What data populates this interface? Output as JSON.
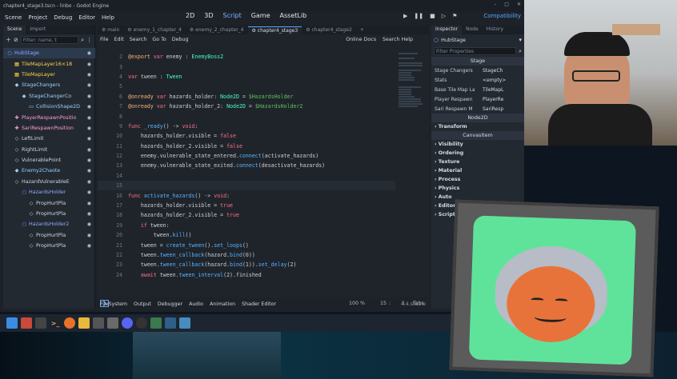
{
  "window": {
    "title": "chapter4_stage3.tscn - linbo - Godot Engine",
    "controls": [
      "–",
      "□",
      "✕"
    ]
  },
  "menu": [
    "Scene",
    "Project",
    "Debug",
    "Editor",
    "Help"
  ],
  "modes": [
    "2D",
    "3D",
    "Script",
    "Game",
    "AssetLib"
  ],
  "active_mode": "Script",
  "compat": "Compatibility",
  "scene_dock": {
    "tabs": [
      "Scene",
      "Import"
    ],
    "filter_placeholder": "Filter: name, t",
    "nodes": [
      {
        "name": "HubStage",
        "depth": 0,
        "icon": "○",
        "color": "#8fa8ff",
        "selected": true
      },
      {
        "name": "TileMapLayer16×18",
        "depth": 1,
        "icon": "▦",
        "color": "#ffd54a"
      },
      {
        "name": "TileMapLayer",
        "depth": 1,
        "icon": "▦",
        "color": "#ffd54a"
      },
      {
        "name": "StageChangers",
        "depth": 1,
        "icon": "◆",
        "color": "#9ad0ff"
      },
      {
        "name": "StageChangerCo",
        "depth": 2,
        "icon": "◆",
        "color": "#9ad0ff"
      },
      {
        "name": "CollisionShape2D",
        "depth": 3,
        "icon": "▭",
        "color": "#9ad0ff"
      },
      {
        "name": "PlayerRespawnPositio",
        "depth": 1,
        "icon": "✚",
        "color": "#ff9bd9"
      },
      {
        "name": "SariRespawnPosition",
        "depth": 1,
        "icon": "✚",
        "color": "#ff9bd9"
      },
      {
        "name": "LeftLimit",
        "depth": 1,
        "icon": "◇",
        "color": "#cfd6df"
      },
      {
        "name": "RightLimit",
        "depth": 1,
        "icon": "◇",
        "color": "#cfd6df"
      },
      {
        "name": "VulnerablePoint",
        "depth": 1,
        "icon": "◇",
        "color": "#cfd6df"
      },
      {
        "name": "Enemy2Chaote",
        "depth": 1,
        "icon": "◆",
        "color": "#9ad0ff"
      },
      {
        "name": "HazardVulnerableE",
        "depth": 1,
        "icon": "◇",
        "color": "#cfd6df"
      },
      {
        "name": "HazardsHolder",
        "depth": 2,
        "icon": "○",
        "color": "#8fa8ff"
      },
      {
        "name": "PropHurtPla",
        "depth": 3,
        "icon": "◇",
        "color": "#cfd6df"
      },
      {
        "name": "PropHurtPla",
        "depth": 3,
        "icon": "◇",
        "color": "#cfd6df"
      },
      {
        "name": "HazardsHolder2",
        "depth": 2,
        "icon": "○",
        "color": "#8fa8ff"
      },
      {
        "name": "PropHurtPla",
        "depth": 3,
        "icon": "◇",
        "color": "#cfd6df"
      },
      {
        "name": "PropHurtPla",
        "depth": 3,
        "icon": "◇",
        "color": "#cfd6df"
      }
    ]
  },
  "script_tabs": [
    "main",
    "enemy_1_chapter_4",
    "enemy_2_chapter_4",
    "chapter4_stage3",
    "chapter4_stage2"
  ],
  "active_script_tab": "chapter4_stage3",
  "editor_menu": [
    "File",
    "Edit",
    "Search",
    "Go To",
    "Debug"
  ],
  "editor_menu_right": [
    "Online Docs",
    "Search Help"
  ],
  "code_lines": [
    {
      "n": "2",
      "tokens": [
        [
          "an",
          "@export "
        ],
        [
          "kw",
          "var "
        ],
        [
          "df",
          "enemy : "
        ],
        [
          "ty",
          "EnemyBoss2"
        ]
      ]
    },
    {
      "n": "3",
      "tokens": []
    },
    {
      "n": "4",
      "tokens": [
        [
          "kw",
          "var "
        ],
        [
          "df",
          "tween : "
        ],
        [
          "ty",
          "Tween"
        ]
      ]
    },
    {
      "n": "5",
      "tokens": []
    },
    {
      "n": "6",
      "tokens": [
        [
          "an",
          "@onready "
        ],
        [
          "kw",
          "var "
        ],
        [
          "df",
          "hazards_holder: "
        ],
        [
          "ty",
          "Node2D "
        ],
        [
          "df",
          "= "
        ],
        [
          "nd",
          "$HazardsHolder"
        ]
      ]
    },
    {
      "n": "7",
      "tokens": [
        [
          "an",
          "@onready "
        ],
        [
          "kw",
          "var "
        ],
        [
          "df",
          "hazards_holder_2: "
        ],
        [
          "ty",
          "Node2D "
        ],
        [
          "df",
          "= "
        ],
        [
          "nd",
          "$HazardsHolder2"
        ]
      ]
    },
    {
      "n": "8",
      "tokens": []
    },
    {
      "n": "9",
      "tokens": [
        [
          "kw",
          "func "
        ],
        [
          "fn",
          "_ready"
        ],
        [
          "df",
          "() -> "
        ],
        [
          "kw",
          "void"
        ],
        [
          "df",
          ":"
        ]
      ]
    },
    {
      "n": "10",
      "tokens": [
        [
          "df",
          "    hazards_holder.visible = "
        ],
        [
          "kw",
          "false"
        ]
      ]
    },
    {
      "n": "11",
      "tokens": [
        [
          "df",
          "    hazards_holder_2.visible = "
        ],
        [
          "kw",
          "false"
        ]
      ]
    },
    {
      "n": "12",
      "tokens": [
        [
          "df",
          "    enemy.vulnerable_state_entered."
        ],
        [
          "fn",
          "connect"
        ],
        [
          "df",
          "(activate_hazards)"
        ]
      ]
    },
    {
      "n": "13",
      "tokens": [
        [
          "df",
          "    enemy.vulnerable_state_exited."
        ],
        [
          "fn",
          "connect"
        ],
        [
          "df",
          "(desactivate_hazards)"
        ]
      ]
    },
    {
      "n": "14",
      "tokens": []
    },
    {
      "n": "15",
      "tokens": [],
      "current": true
    },
    {
      "n": "16",
      "tokens": [
        [
          "kw",
          "func "
        ],
        [
          "fn",
          "activate_hazards"
        ],
        [
          "df",
          "() -> "
        ],
        [
          "kw",
          "void"
        ],
        [
          "df",
          ":"
        ]
      ]
    },
    {
      "n": "17",
      "tokens": [
        [
          "df",
          "    hazards_holder.visible = "
        ],
        [
          "kw",
          "true"
        ]
      ]
    },
    {
      "n": "18",
      "tokens": [
        [
          "df",
          "    hazards_holder_2.visible = "
        ],
        [
          "kw",
          "true"
        ]
      ]
    },
    {
      "n": "19",
      "tokens": [
        [
          "kw",
          "    if "
        ],
        [
          "df",
          "tween:"
        ]
      ]
    },
    {
      "n": "20",
      "tokens": [
        [
          "df",
          "        tween."
        ],
        [
          "fn",
          "kill"
        ],
        [
          "df",
          "()"
        ]
      ]
    },
    {
      "n": "21",
      "tokens": [
        [
          "df",
          "    tween = "
        ],
        [
          "fn",
          "create_tween"
        ],
        [
          "df",
          "()."
        ],
        [
          "fn",
          "set_loops"
        ],
        [
          "df",
          "()"
        ]
      ]
    },
    {
      "n": "22",
      "tokens": [
        [
          "df",
          "    tween."
        ],
        [
          "fn",
          "tween_callback"
        ],
        [
          "df",
          "(hazard."
        ],
        [
          "fn",
          "bind"
        ],
        [
          "df",
          "(0))"
        ]
      ]
    },
    {
      "n": "23",
      "tokens": [
        [
          "df",
          "    tween."
        ],
        [
          "fn",
          "tween_callback"
        ],
        [
          "df",
          "(hazard."
        ],
        [
          "fn",
          "bind"
        ],
        [
          "df",
          "(1))."
        ],
        [
          "fn",
          "set_delay"
        ],
        [
          "df",
          "(2)"
        ]
      ]
    },
    {
      "n": "24",
      "tokens": [
        [
          "kw",
          "    await "
        ],
        [
          "df",
          "tween."
        ],
        [
          "fn",
          "tween_interval"
        ],
        [
          "df",
          "(2).finished"
        ]
      ]
    }
  ],
  "editor_status": {
    "zoom": "100 %",
    "line": "15",
    "col": "1",
    "indent": "Tabs"
  },
  "bottom_panels": [
    "FileSystem",
    "Output",
    "Debugger",
    "Audio",
    "Animation",
    "Shader Editor"
  ],
  "version": "4.4.stable",
  "inspector": {
    "tabs": [
      "Inspector",
      "Node",
      "History"
    ],
    "node_name": "HubStage",
    "filter": "Filter Properties",
    "class_header": "Stage",
    "props": [
      {
        "k": "Stage Changers",
        "v": "StageCh"
      },
      {
        "k": "Stats",
        "v": "<empty>"
      },
      {
        "k": "Base Tile Map La",
        "v": "TileMapL"
      },
      {
        "k": "Player Respawn",
        "v": "PlayerRe"
      },
      {
        "k": "Sari Respawn M",
        "v": "SariResp"
      }
    ],
    "node2d_header": "Node2D",
    "node2d_sections": [
      "Transform"
    ],
    "canvas_header": "CanvasItem",
    "canvas_sections": [
      "Visibility",
      "Ordering",
      "Texture",
      "Material"
    ],
    "node_sections": [
      "Process",
      "Physics",
      "Auto",
      "Editor",
      "Script"
    ]
  }
}
